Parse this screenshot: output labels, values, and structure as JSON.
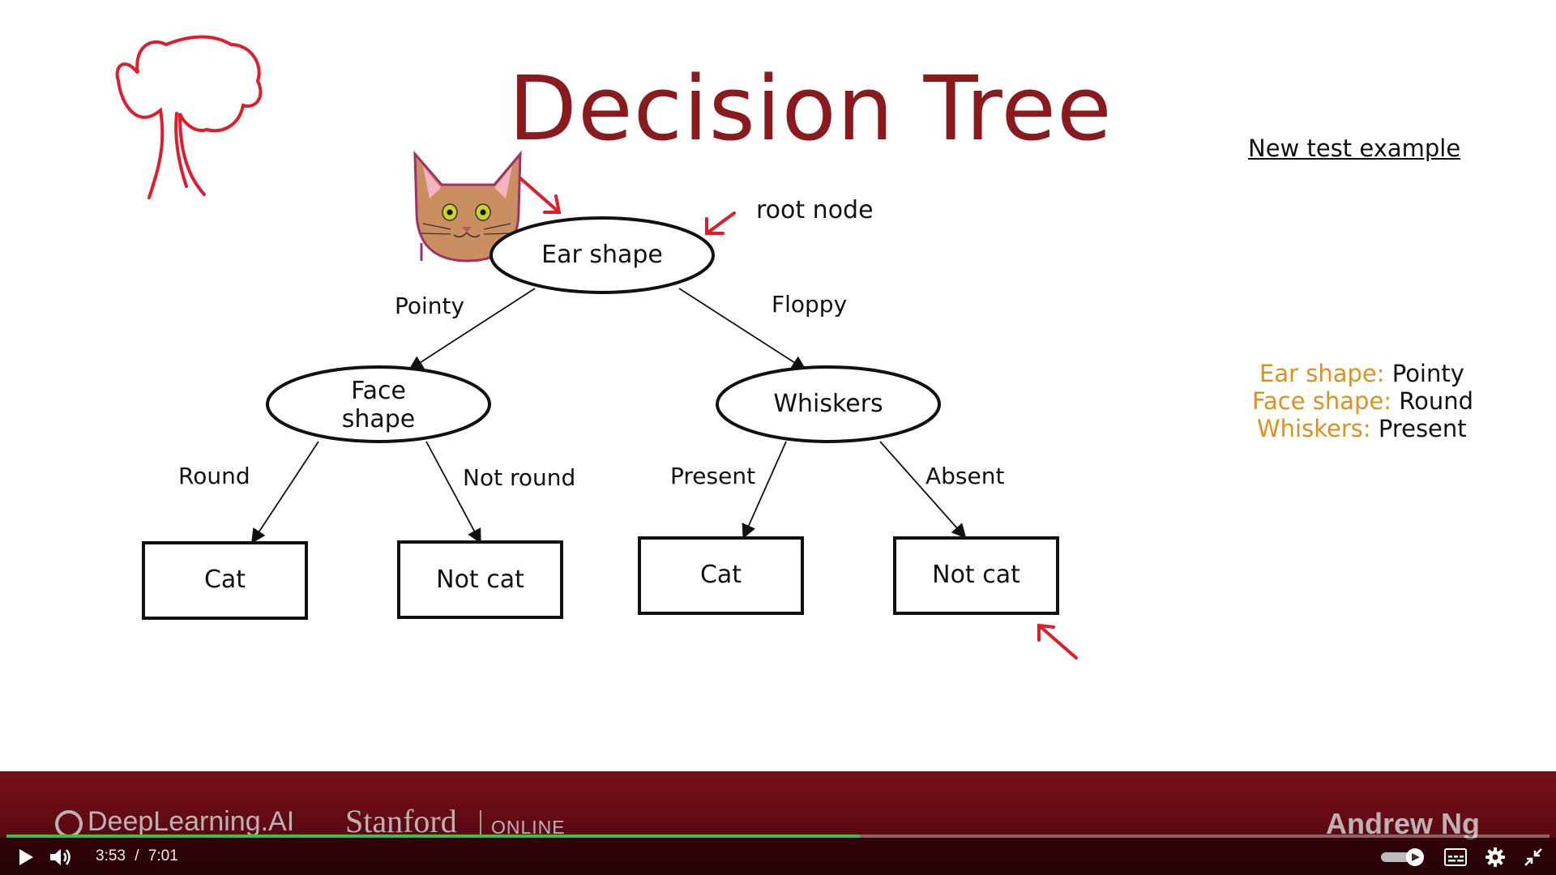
{
  "slide": {
    "title": "Decision Tree",
    "annotation": "root node",
    "test_example_link": "New test example",
    "test_features": [
      {
        "key": "Ear shape:",
        "value": "Pointy"
      },
      {
        "key": "Face shape:",
        "value": "Round"
      },
      {
        "key": "Whiskers:",
        "value": "Present"
      }
    ],
    "tree": {
      "root": "Ear shape",
      "left_internal": [
        "Face",
        "shape"
      ],
      "right_internal": "Whiskers",
      "edges": {
        "pointy": "Pointy",
        "floppy": "Floppy",
        "round": "Round",
        "not_round": "Not round",
        "present": "Present",
        "absent": "Absent"
      },
      "leaves": [
        "Cat",
        "Not cat",
        "Cat",
        "Not cat"
      ]
    },
    "colors": {
      "title": "#8b1a1f",
      "feature_key": "#e0901a",
      "ink": "#e01b2a"
    }
  },
  "banner": {
    "brand_left": "DeepLearning.AI",
    "brand_mid": "Stanford",
    "brand_mid_sub": "ONLINE",
    "presenter": "Andrew Ng"
  },
  "player": {
    "current_time": "3:53",
    "separator": "/",
    "duration": "7:01",
    "progress_fraction": 0.553,
    "icons": [
      "play-icon",
      "volume-icon",
      "autoplay-toggle-icon",
      "captions-icon",
      "settings-icon",
      "exit-fullscreen-icon"
    ]
  }
}
